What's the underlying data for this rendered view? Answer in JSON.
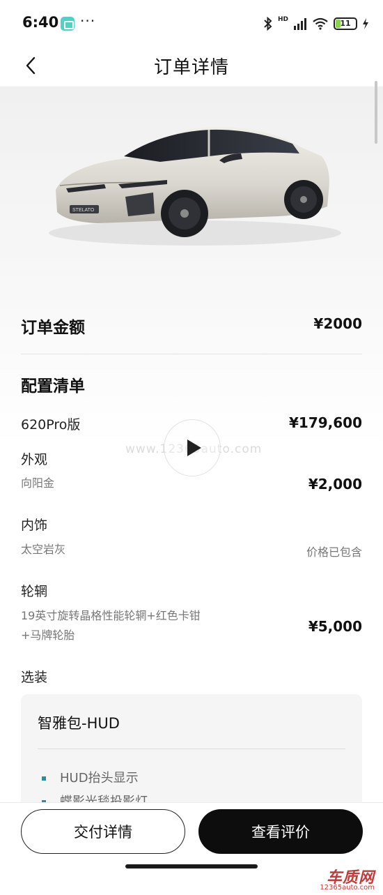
{
  "status_bar": {
    "time": "6:40",
    "dots": "···",
    "network": "HD",
    "battery": "11"
  },
  "nav": {
    "title": "订单详情",
    "back_icon": "chevron-left-icon"
  },
  "hero": {
    "car_badge": "STELATO"
  },
  "order_amount": {
    "label": "订单金额",
    "value": "¥2000"
  },
  "config": {
    "title": "配置清单",
    "version": {
      "name": "620Pro版",
      "price": "¥179,600"
    },
    "exterior": {
      "label": "外观",
      "value": "向阳金",
      "price": "¥2,000"
    },
    "interior": {
      "label": "内饰",
      "value": "太空岩灰",
      "price": "价格已包含"
    },
    "wheels": {
      "label": "轮辋",
      "value_line1": "19英寸旋转晶格性能轮辋+红色卡钳",
      "value_line2": "+马牌轮胎",
      "price": "¥5,000"
    },
    "options_label": "选装"
  },
  "option_package": {
    "title": "智雅包-HUD",
    "features": [
      "HUD抬头显示",
      "蝶影光毯投影灯"
    ]
  },
  "watermark": {
    "center_text": "www.12365auto.com",
    "logo_main": "车质网",
    "logo_sub": "12365auto.com"
  },
  "actions": {
    "delivery_details": "交付详情",
    "view_reviews": "查看评价"
  },
  "colors": {
    "accent_bullet": "#2b8ca8",
    "primary_button": "#0d0d0d"
  }
}
